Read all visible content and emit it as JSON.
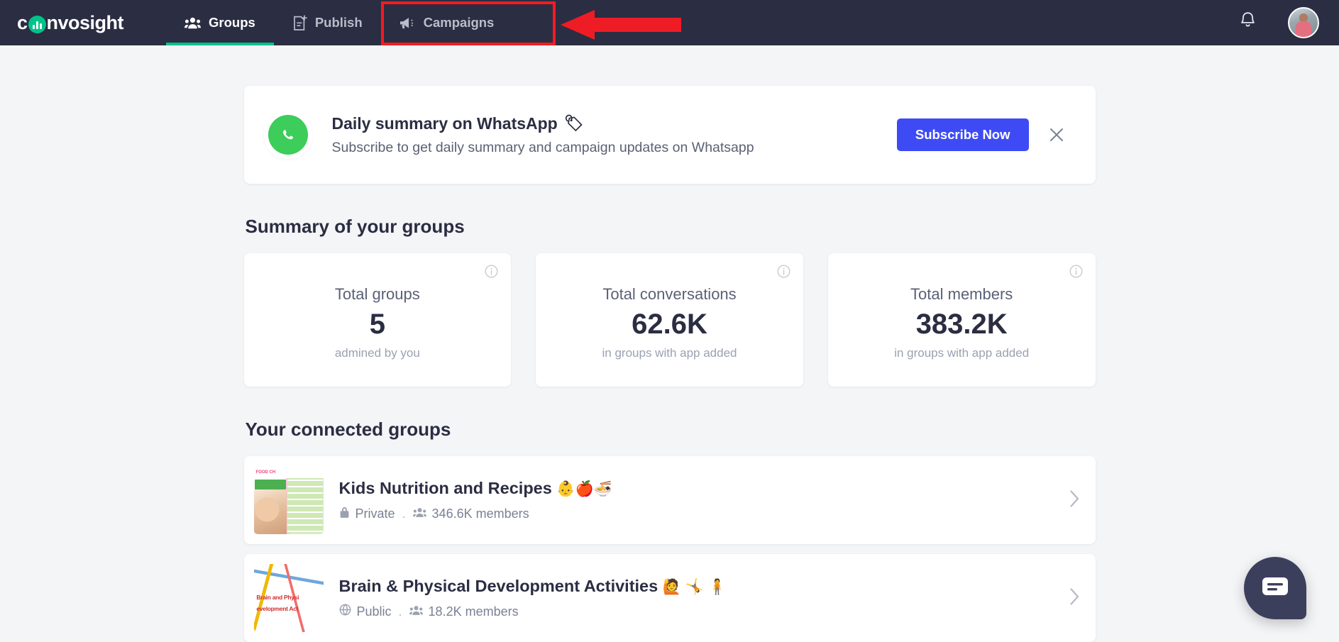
{
  "brand": {
    "name_before": "c",
    "mark": "o-logo-icon",
    "name_after": "nvosight"
  },
  "nav": {
    "tabs": [
      {
        "id": "groups",
        "label": "Groups",
        "icon": "people-icon",
        "active": true
      },
      {
        "id": "publish",
        "label": "Publish",
        "icon": "document-plus-icon",
        "active": false
      },
      {
        "id": "campaigns",
        "label": "Campaigns",
        "icon": "megaphone-icon",
        "active": false
      }
    ],
    "bell": "notification-bell-icon",
    "avatar": "user-avatar"
  },
  "annotation": {
    "highlight_target": "Campaigns",
    "box_color": "#f51b21",
    "arrow_color": "#ee1c25",
    "arrow_direction": "left"
  },
  "banner": {
    "icon": "whatsapp-icon",
    "title": "Daily summary on WhatsApp",
    "title_emoji": "🏷",
    "subtitle": "Subscribe to get daily summary and campaign updates on Whatsapp",
    "cta_label": "Subscribe Now",
    "cta_color": "#3e4bf5",
    "close_icon": "close-icon"
  },
  "summary": {
    "heading": "Summary of your groups",
    "cards": [
      {
        "label": "Total groups",
        "value": "5",
        "footnote": "admined by you",
        "info_icon": "info-icon"
      },
      {
        "label": "Total conversations",
        "value": "62.6K",
        "footnote": "in groups with app added",
        "info_icon": "info-icon"
      },
      {
        "label": "Total members",
        "value": "383.2K",
        "footnote": "in groups with app added",
        "info_icon": "info-icon"
      }
    ]
  },
  "connected": {
    "heading": "Your connected groups",
    "groups": [
      {
        "name": "Kids Nutrition and Recipes",
        "emojis": "👶🍎🍜",
        "privacy": "Private",
        "privacy_icon": "lock-icon",
        "members": "346.6K members",
        "members_icon": "people-icon",
        "separator": ".",
        "chevron": "chevron-right-icon",
        "thumbnail": "kids-nutrition-food-chart-thumbnail"
      },
      {
        "name": "Brain & Physical Development Activities",
        "emojis": "🙋 🤸 🧍",
        "privacy": "Public",
        "privacy_icon": "globe-icon",
        "members": "18.2K members",
        "members_icon": "people-icon",
        "separator": ".",
        "chevron": "chevron-right-icon",
        "thumbnail": "brain-physical-development-thumbnail"
      }
    ]
  },
  "chat_widget": {
    "icon": "chat-bubble-icon",
    "color": "#3c3f5c"
  },
  "thumb_text": {
    "a_header": "FOOD CH",
    "b_line1": "Brain and Physi",
    "b_line2": "evelopment Act"
  }
}
